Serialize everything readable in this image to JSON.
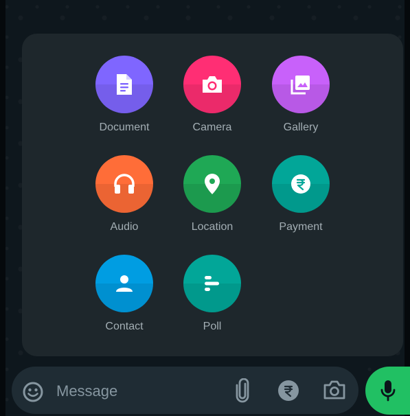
{
  "attach_menu": {
    "items": [
      {
        "label": "Document",
        "icon": "document-icon",
        "color": "#7f66ff"
      },
      {
        "label": "Camera",
        "icon": "camera-icon",
        "color": "#ff2e74"
      },
      {
        "label": "Gallery",
        "icon": "gallery-icon",
        "color": "#c861fa"
      },
      {
        "label": "Audio",
        "icon": "headphones-icon",
        "color": "#ff6d38"
      },
      {
        "label": "Location",
        "icon": "location-pin-icon",
        "color": "#1fa855"
      },
      {
        "label": "Payment",
        "icon": "rupee-icon",
        "color": "#02a698"
      },
      {
        "label": "Contact",
        "icon": "person-icon",
        "color": "#009de2"
      },
      {
        "label": "Poll",
        "icon": "poll-icon",
        "color": "#02a698"
      }
    ]
  },
  "composer": {
    "placeholder": "Message",
    "emoji_icon": "emoji-icon",
    "attach_icon": "paperclip-icon",
    "payment_icon": "rupee-icon",
    "camera_icon": "camera-icon",
    "send_icon": "microphone-icon",
    "send_color": "#21c063"
  }
}
